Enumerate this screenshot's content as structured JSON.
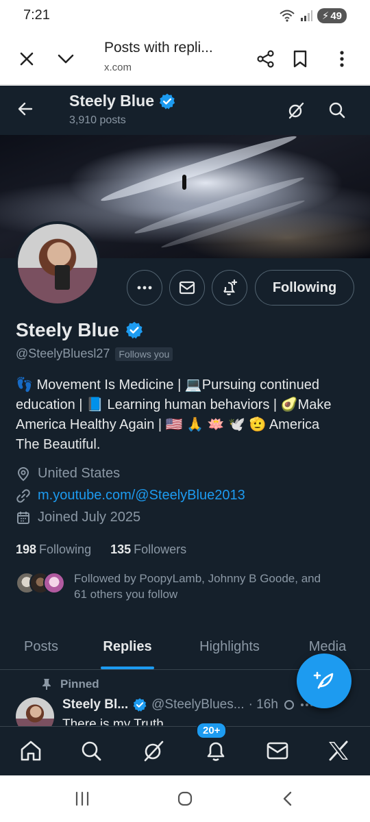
{
  "status_bar": {
    "time": "7:21",
    "battery": "49"
  },
  "browser": {
    "page_title": "Posts with repli...",
    "url": "x.com"
  },
  "header": {
    "name": "Steely Blue",
    "post_count": "3,910 posts"
  },
  "profile": {
    "name": "Steely Blue",
    "handle": "@SteelyBluesl27",
    "follows_you": "Follows you",
    "following_label": "Following",
    "bio_line1": "👣 Movement Is Medicine  | 💻Pursuing continued",
    "bio_line2": "education | 📘 Learning human behaviors | 🥑Make",
    "bio_line3": "America Healthy Again | 🇺🇸 🙏 🪷 🕊️ 🫡 America",
    "bio_line4": "The Beautiful.",
    "location": "United States",
    "website": "m.youtube.com/@SteelyBlue2013",
    "joined": "Joined July 2025",
    "following_count": "198",
    "following_text": "Following",
    "followers_count": "135",
    "followers_text": "Followers",
    "followed_by_line1": "Followed by PoopyLamb, Johnny B Goode, and",
    "followed_by_line2": "61 others you follow"
  },
  "tabs": [
    {
      "label": "Posts"
    },
    {
      "label": "Replies"
    },
    {
      "label": "Highlights"
    },
    {
      "label": "Media"
    }
  ],
  "active_tab": "Replies",
  "post": {
    "pinned_label": "Pinned",
    "author": "Steely Bl...",
    "handle": "@SteelyBlues...",
    "time": "· 16h",
    "text": "There is my Truth"
  },
  "bottom_nav": {
    "notification_badge": "20+"
  },
  "colors": {
    "background": "#15202b",
    "accent": "#1d9bf0",
    "muted": "#8b98a5",
    "text": "#e7e9ea"
  }
}
